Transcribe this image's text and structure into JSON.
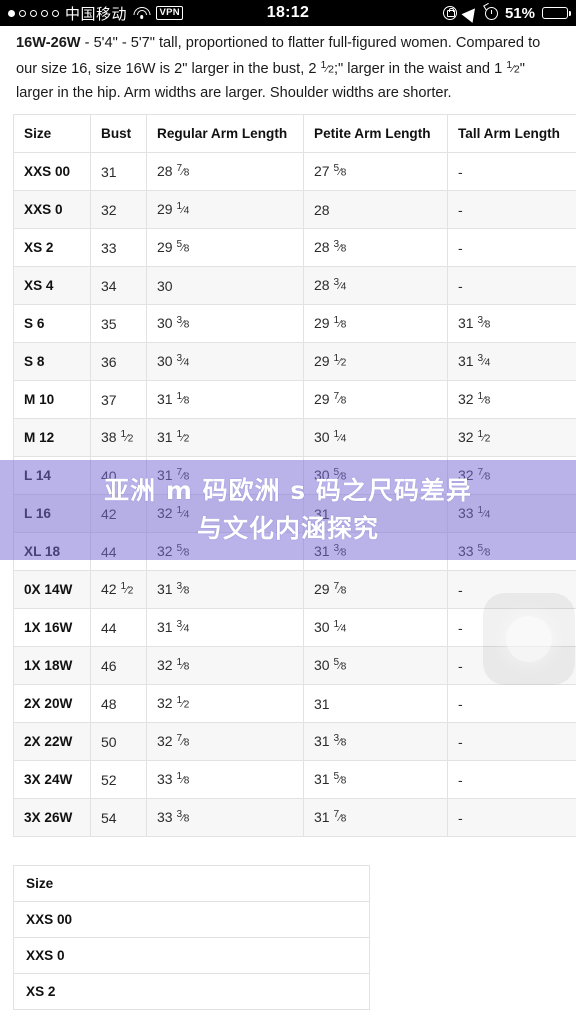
{
  "status_bar": {
    "signal_dots_total": 5,
    "signal_dots_filled": 1,
    "carrier": "中国移动",
    "wifi_icon": "wifi-icon",
    "vpn_label": "VPN",
    "time": "18:12",
    "rotation_lock_icon": "rotation-lock-icon",
    "location_icon": "location-arrow-icon",
    "alarm_icon": "alarm-clock-icon",
    "battery_percent": "51%",
    "battery_level": 51
  },
  "content": {
    "paragraph": {
      "lead": "16W-26W",
      "rest_1": " - 5'4\" - 5'7\" tall, proportioned to flatter full-figured women. Compared to our size 16, size 16W is 2\" larger in the bust, 2 ",
      "frac_1_num": "1",
      "frac_1_den": "2",
      "rest_2": ";\" larger in the waist and 1 ",
      "frac_2_num": "1",
      "frac_2_den": "2",
      "rest_3": "\" larger in the hip. Arm widths are larger. Shoulder widths are shorter."
    }
  },
  "size_table": {
    "headers": [
      "Size",
      "Bust",
      "Regular Arm Length",
      "Petite Arm Length",
      "Tall Arm Length"
    ],
    "rows": [
      {
        "size": "XXS 00",
        "bust": "31",
        "regular": "28 7/8",
        "petite": "27 5/8",
        "tall": "-"
      },
      {
        "size": "XXS 0",
        "bust": "32",
        "regular": "29 1/4",
        "petite": "28",
        "tall": "-"
      },
      {
        "size": "XS 2",
        "bust": "33",
        "regular": "29 5/8",
        "petite": "28 3/8",
        "tall": "-"
      },
      {
        "size": "XS 4",
        "bust": "34",
        "regular": "30",
        "petite": "28 3/4",
        "tall": "-"
      },
      {
        "size": "S 6",
        "bust": "35",
        "regular": "30 3/8",
        "petite": "29 1/8",
        "tall": "31 3/8"
      },
      {
        "size": "S 8",
        "bust": "36",
        "regular": "30 3/4",
        "petite": "29 1/2",
        "tall": "31 3/4"
      },
      {
        "size": "M 10",
        "bust": "37",
        "regular": "31 1/8",
        "petite": "29 7/8",
        "tall": "32 1/8"
      },
      {
        "size": "M 12",
        "bust": "38 1/2",
        "regular": "31 1/2",
        "petite": "30 1/4",
        "tall": "32 1/2"
      },
      {
        "size": "L 14",
        "bust": "40",
        "regular": "31 7/8",
        "petite": "30 5/8",
        "tall": "32 7/8"
      },
      {
        "size": "L 16",
        "bust": "42",
        "regular": "32 1/4",
        "petite": "31",
        "tall": "33 1/4"
      },
      {
        "size": "XL 18",
        "bust": "44",
        "regular": "32 5/8",
        "petite": "31 3/8",
        "tall": "33 5/8"
      },
      {
        "size": "0X 14W",
        "bust": "42 1/2",
        "regular": "31 3/8",
        "petite": "29 7/8",
        "tall": "-"
      },
      {
        "size": "1X 16W",
        "bust": "44",
        "regular": "31 3/4",
        "petite": "30 1/4",
        "tall": "-"
      },
      {
        "size": "1X 18W",
        "bust": "46",
        "regular": "32 1/8",
        "petite": "30 5/8",
        "tall": "-"
      },
      {
        "size": "2X 20W",
        "bust": "48",
        "regular": "32 1/2",
        "petite": "31",
        "tall": "-"
      },
      {
        "size": "2X 22W",
        "bust": "50",
        "regular": "32 7/8",
        "petite": "31 3/8",
        "tall": "-"
      },
      {
        "size": "3X 24W",
        "bust": "52",
        "regular": "33 1/8",
        "petite": "31 5/8",
        "tall": "-"
      },
      {
        "size": "3X 26W",
        "bust": "54",
        "regular": "33 3/8",
        "petite": "31 7/8",
        "tall": "-"
      }
    ]
  },
  "size_table_2": {
    "header": "Size",
    "rows": [
      "XXS 00",
      "XXS 0",
      "XS 2"
    ]
  },
  "overlay_banner": {
    "line1": "亚洲 m 码欧洲 s 码之尺码差异",
    "line2": "与文化内涵探究",
    "background_color": "#786ED7",
    "text_color": "#FFFFFF"
  },
  "watermark": {
    "icon": "assistive-touch-icon"
  }
}
